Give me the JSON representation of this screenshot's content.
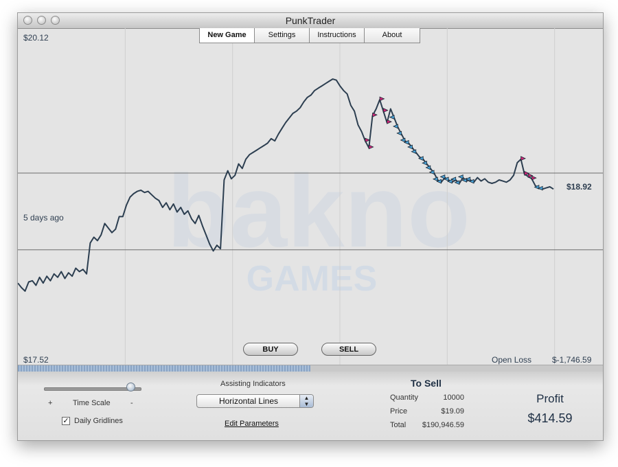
{
  "window": {
    "title": "PunkTrader"
  },
  "tabs": [
    {
      "label": "New Game"
    },
    {
      "label": "Settings"
    },
    {
      "label": "Instructions"
    },
    {
      "label": "About"
    }
  ],
  "chart": {
    "price_high": "$20.12",
    "price_low": "$17.52",
    "time_label": "5 days ago",
    "current_price": "$18.92",
    "open_loss_label": "Open Loss",
    "open_loss_value": "$-1,746.59",
    "watermark_logo": "bakno",
    "watermark_sub": "GAMES"
  },
  "chart_data": {
    "type": "line",
    "title": "",
    "ylim": [
      17.52,
      20.12
    ],
    "last_value": 18.92,
    "horizontal_lines": [
      19.06,
      18.39
    ],
    "series": [
      {
        "values": [
          18.1,
          18.06,
          18.03,
          18.11,
          18.12,
          18.08,
          18.15,
          18.1,
          18.16,
          18.12,
          18.18,
          18.15,
          18.2,
          18.14,
          18.19,
          18.16,
          18.23,
          18.2,
          18.22,
          18.18,
          18.45,
          18.5,
          18.47,
          18.52,
          18.62,
          18.58,
          18.54,
          18.57,
          18.68,
          18.68,
          18.78,
          18.85,
          18.88,
          18.9,
          18.91,
          18.89,
          18.9,
          18.87,
          18.84,
          18.82,
          18.76,
          18.8,
          18.74,
          18.79,
          18.72,
          18.76,
          18.7,
          18.73,
          18.66,
          18.62,
          18.69,
          18.6,
          18.52,
          18.44,
          18.38,
          18.43,
          18.4,
          19.0,
          19.08,
          19.01,
          19.04,
          19.14,
          19.1,
          19.18,
          19.22,
          19.24,
          19.26,
          19.28,
          19.3,
          19.32,
          19.36,
          19.34,
          19.4,
          19.45,
          19.5,
          19.54,
          19.58,
          19.6,
          19.63,
          19.68,
          19.72,
          19.74,
          19.78,
          19.8,
          19.82,
          19.84,
          19.86,
          19.88,
          19.87,
          19.82,
          19.78,
          19.75,
          19.65,
          19.6,
          19.48,
          19.42,
          19.34,
          19.28,
          19.56,
          19.62,
          19.7,
          19.6,
          19.5,
          19.62,
          19.54,
          19.46,
          19.4,
          19.34,
          19.32,
          19.28,
          19.24,
          19.2,
          19.18,
          19.14,
          19.1,
          19.06,
          19.0,
          18.98,
          19.02,
          19.0,
          18.98,
          19.0,
          18.97,
          19.02,
          18.99,
          19.0,
          18.98,
          19.02,
          18.99,
          19.01,
          18.98,
          18.97,
          18.98,
          19.0,
          18.99,
          18.98,
          19.0,
          19.04,
          19.15,
          19.18,
          19.05,
          19.03,
          19.01,
          18.95,
          18.93,
          18.92,
          18.93,
          18.94,
          18.92
        ]
      }
    ]
  },
  "buttons": {
    "buy": "BUY",
    "sell": "SELL"
  },
  "controls": {
    "time_scale_label": "Time Scale",
    "plus": "+",
    "minus": "-",
    "time_scale_value": 0.9,
    "daily_gridlines_label": "Daily Gridlines",
    "daily_gridlines_checked": true,
    "check_mark": "✓",
    "scroll_position": 0.5
  },
  "indicators": {
    "label": "Assisting Indicators",
    "selected": "Horizontal Lines",
    "arrow_up": "▲",
    "arrow_down": "▼",
    "edit_link": "Edit Parameters"
  },
  "to_sell": {
    "title": "To Sell",
    "rows": [
      {
        "label": "Quantity",
        "value": "10000"
      },
      {
        "label": "Price",
        "value": "$19.09"
      },
      {
        "label": "Total",
        "value": "$190,946.59"
      }
    ]
  },
  "profit": {
    "label": "Profit",
    "value": "$414.59"
  },
  "colors": {
    "price_line": "#2c3e50",
    "buy_marker": "#4aa3d8",
    "sell_marker": "#d1287a",
    "gridline": "#999999"
  }
}
